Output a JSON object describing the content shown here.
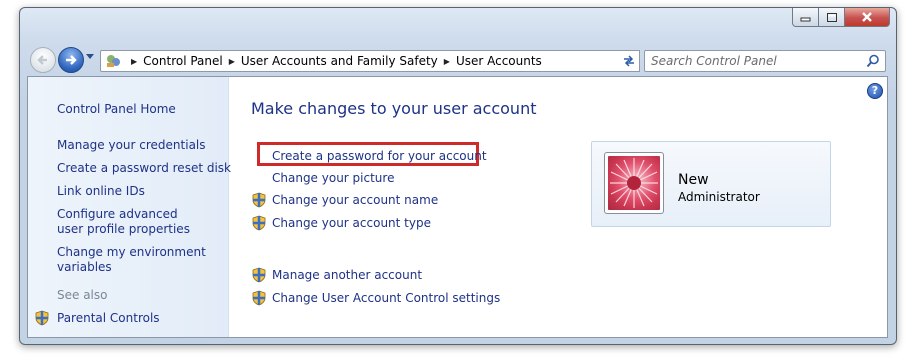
{
  "window": {
    "minimize_icon": "minimize-icon",
    "maximize_icon": "maximize-icon",
    "close_icon": "close-icon"
  },
  "navigation": {
    "back_icon": "back-arrow-icon",
    "forward_icon": "forward-arrow-icon",
    "recent_icon": "chevron-down-icon",
    "breadcrumb": [
      "Control Panel",
      "User Accounts and Family Safety",
      "User Accounts"
    ],
    "search_placeholder": "Search Control Panel"
  },
  "sidebar": {
    "home": "Control Panel Home",
    "links": [
      "Manage your credentials",
      "Create a password reset disk",
      "Link online IDs",
      "Configure advanced user profile properties",
      "Change my environment variables"
    ],
    "see_also_label": "See also",
    "see_also_links": [
      "Parental Controls"
    ]
  },
  "main": {
    "title": "Make changes to your user account",
    "tasks": [
      {
        "label": "Create a password for your account",
        "shield": false,
        "highlighted": true
      },
      {
        "label": "Change your picture",
        "shield": false
      },
      {
        "label": "Change your account name",
        "shield": true
      },
      {
        "label": "Change your account type",
        "shield": true
      }
    ],
    "other_tasks": [
      {
        "label": "Manage another account",
        "shield": true
      },
      {
        "label": "Change User Account Control settings",
        "shield": true
      }
    ],
    "help_icon": "?"
  },
  "user": {
    "name": "New",
    "role": "Administrator"
  },
  "colors": {
    "link": "#1e3287",
    "highlight": "#cf2a2a"
  }
}
